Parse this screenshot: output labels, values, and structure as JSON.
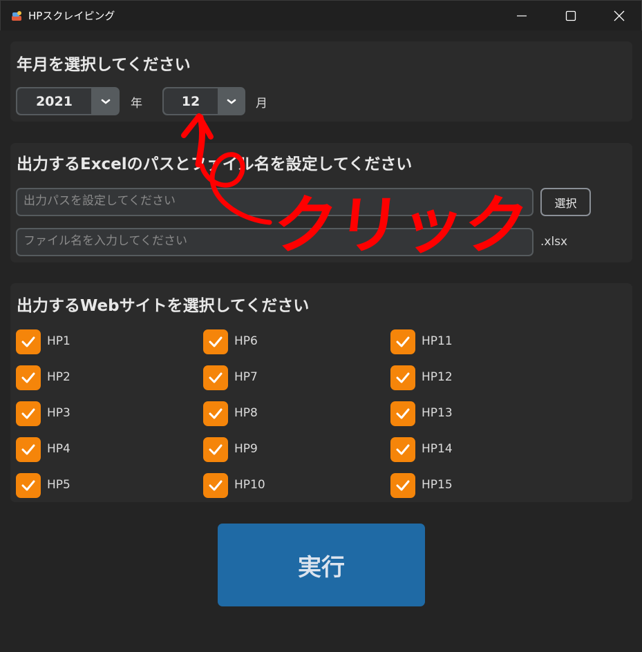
{
  "window": {
    "title": "HPスクレイピング"
  },
  "date_panel": {
    "heading": "年月を選択してください",
    "year": {
      "value": "2021",
      "unit": "年"
    },
    "month": {
      "value": "12",
      "unit": "月"
    }
  },
  "output_panel": {
    "heading": "出力するExcelのパスとファイル名を設定してください",
    "path_field": {
      "value": "",
      "placeholder": "出力パスを設定してください"
    },
    "select_button": "選択",
    "filename_field": {
      "value": "",
      "placeholder": "ファイル名を入力してください"
    },
    "extension": ".xlsx"
  },
  "sites_panel": {
    "heading": "出力するWebサイトを選択してください",
    "sites": [
      {
        "label": "HP1",
        "checked": true
      },
      {
        "label": "HP2",
        "checked": true
      },
      {
        "label": "HP3",
        "checked": true
      },
      {
        "label": "HP4",
        "checked": true
      },
      {
        "label": "HP5",
        "checked": true
      },
      {
        "label": "HP6",
        "checked": true
      },
      {
        "label": "HP7",
        "checked": true
      },
      {
        "label": "HP8",
        "checked": true
      },
      {
        "label": "HP9",
        "checked": true
      },
      {
        "label": "HP10",
        "checked": true
      },
      {
        "label": "HP11",
        "checked": true
      },
      {
        "label": "HP12",
        "checked": true
      },
      {
        "label": "HP13",
        "checked": true
      },
      {
        "label": "HP14",
        "checked": true
      },
      {
        "label": "HP15",
        "checked": true
      }
    ]
  },
  "run_button": "実行",
  "annotation": {
    "text": "クリック",
    "color": "#ff0000"
  },
  "colors": {
    "accent": "#f5850a",
    "primary": "#1f6aa5",
    "background": "#242424",
    "panel": "#2b2b2b"
  },
  "icons": {
    "app": "scraper-app-icon",
    "minimize": "minimize-icon",
    "maximize": "maximize-icon",
    "close": "close-icon",
    "dropdown": "chevron-down-icon",
    "check": "check-icon"
  }
}
